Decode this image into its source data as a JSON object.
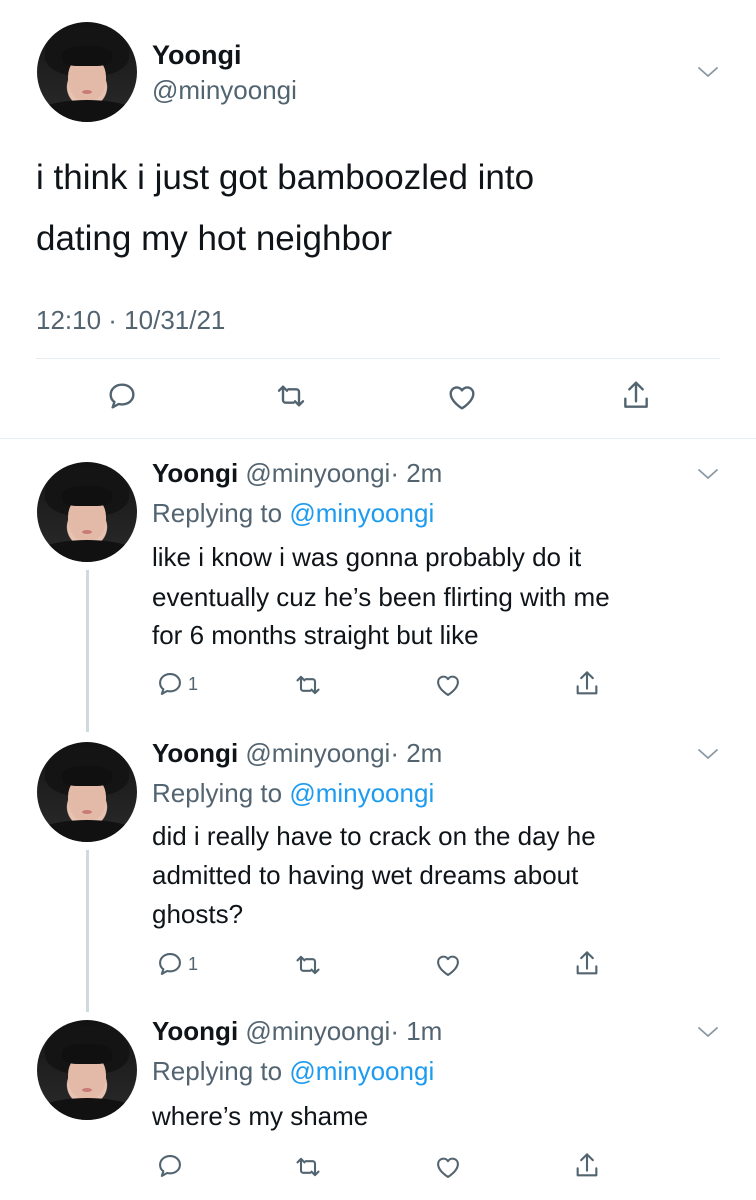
{
  "main_tweet": {
    "display_name": "Yoongi",
    "handle": "@minyoongi",
    "text_line1": "i think i just got bamboozled into",
    "text_line2": "dating my hot neighbor",
    "timestamp": "12:10 · 10/31/21",
    "actions": [
      "reply-icon",
      "retweet-icon",
      "like-icon",
      "share-icon"
    ]
  },
  "replies": [
    {
      "display_name": "Yoongi",
      "handle": "@minyoongi",
      "time": "· 2m",
      "replying_prefix": "Replying to",
      "replying_to": "@minyoongi",
      "lines": [
        "like i know i was gonna probably do it",
        "eventually cuz he’s been flirting with me",
        "for 6 months straight but like"
      ],
      "reply_count": "1"
    },
    {
      "display_name": "Yoongi",
      "handle": "@minyoongi",
      "time": "· 2m",
      "replying_prefix": "Replying to",
      "replying_to": "@minyoongi",
      "lines": [
        "did i really have to crack on the day he",
        "admitted to having wet dreams about",
        "ghosts?"
      ],
      "reply_count": "1"
    },
    {
      "display_name": "Yoongi",
      "handle": "@minyoongi",
      "time": "· 1m",
      "replying_prefix": "Replying to",
      "replying_to": "@minyoongi",
      "lines": [
        "where’s my shame"
      ],
      "reply_count": ""
    }
  ],
  "colors": {
    "accent": "#1d9bf0",
    "secondary_text": "#536471",
    "thread_line": "#cfd9de"
  }
}
